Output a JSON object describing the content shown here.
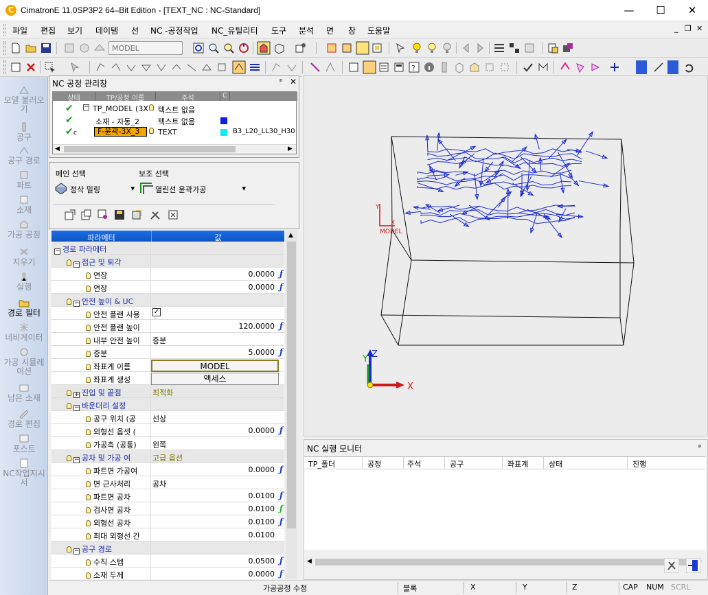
{
  "window": {
    "title": "CimatronE 11.0SP3P2 64–Bit Edition - [TEXT_NC : NC-Standard]",
    "app_icon": "C",
    "minimize": "—",
    "maximize": "☐",
    "close": "✕"
  },
  "menu": {
    "items": [
      "파일",
      "편집",
      "보기",
      "데이템",
      "선",
      "NC -공정작업",
      "NC_유틸리티",
      "도구",
      "분석",
      "면",
      "창",
      "도움말"
    ],
    "mdi_minimize": "_",
    "mdi_restore": "❐",
    "mdi_close": "✕"
  },
  "toolbar": {
    "model_select": "MODEL"
  },
  "left_bar": {
    "items": [
      "모델 불러오기",
      "공구",
      "공구 경로",
      "파트",
      "소재",
      "가공 공정",
      "지우기",
      "실행",
      "경로 필터",
      "네비게이터",
      "가공 시뮬레이션",
      "남은 소재",
      "경로 편집",
      "포스트",
      "NC작업지시서"
    ]
  },
  "nc_manager": {
    "title": "NC 공정 관리창",
    "pin": "ᵖ",
    "close": "✕",
    "columns": [
      "상태",
      "TP/공정 이름",
      "주석",
      "C"
    ],
    "rows": [
      {
        "name": "TP_MODEL (3X",
        "comment": "텍스트 없음",
        "color": "",
        "extra": ""
      },
      {
        "name": "소재 - 자동_2",
        "comment": "텍스트 없음",
        "color": "#0a1ee6",
        "extra": ""
      },
      {
        "name": "F-윤곽-3X_3",
        "comment": "TEXT",
        "color": "#11ecf4",
        "extra": "B3_L20_LL30_H30",
        "flag": "c"
      }
    ]
  },
  "process": {
    "main_label": "메인 선택",
    "sub_label": "보조 선택",
    "main_value": "정삭 밀링",
    "sub_value": "열린선 윤곽가공"
  },
  "params": {
    "col_param": "파라메터",
    "col_value": "값",
    "rows": [
      {
        "level": 0,
        "type": "group",
        "name": "경로 파라메터",
        "expand": "−"
      },
      {
        "level": 1,
        "type": "group",
        "name": "접근 및 퇴각",
        "expand": "−"
      },
      {
        "level": 2,
        "type": "num",
        "name": "연장",
        "value": "0.0000",
        "fx": "f"
      },
      {
        "level": 2,
        "type": "num",
        "name": "연장",
        "value": "0.0000",
        "fx": "f"
      },
      {
        "level": 1,
        "type": "group",
        "name": "안전 높이 & UC",
        "expand": "−"
      },
      {
        "level": 2,
        "type": "check",
        "name": "안전 플랜 사용",
        "value": "✓"
      },
      {
        "level": 2,
        "type": "num",
        "name": "안전 플랜 높이",
        "value": "120.0000",
        "fx": "f"
      },
      {
        "level": 2,
        "type": "text",
        "name": "내부 안전 높이",
        "value": "증분"
      },
      {
        "level": 2,
        "type": "num",
        "name": "증분",
        "value": "5.0000",
        "fx": "f"
      },
      {
        "level": 2,
        "type": "button",
        "name": "좌표계 이름",
        "value": "MODEL"
      },
      {
        "level": 2,
        "type": "button2",
        "name": "좌표계 생성",
        "value": "액세스"
      },
      {
        "level": 1,
        "type": "group",
        "name": "진입 및 끝점",
        "expand": "+",
        "value": "최적화"
      },
      {
        "level": 1,
        "type": "group",
        "name": "바운더리 설정",
        "expand": "−"
      },
      {
        "level": 2,
        "type": "text",
        "name": "공구 위치 (공",
        "value": "선상"
      },
      {
        "level": 2,
        "type": "num",
        "name": "외형선 옵셋 (",
        "value": "0.0000",
        "fx": "f"
      },
      {
        "level": 2,
        "type": "text",
        "name": "가공측 (공통)",
        "value": "왼쪽"
      },
      {
        "level": 1,
        "type": "group",
        "name": "공차 및 가공 여",
        "expand": "−",
        "value": "고급 옵션"
      },
      {
        "level": 2,
        "type": "num",
        "name": "파트면 가공여",
        "value": "0.0000",
        "fx": "f"
      },
      {
        "level": 2,
        "type": "text",
        "name": "면 근사처리",
        "value": "공차"
      },
      {
        "level": 2,
        "type": "num",
        "name": "파트면 공차",
        "value": "0.0100",
        "fx": "f"
      },
      {
        "level": 2,
        "type": "num",
        "name": "검사면 공차",
        "value": "0.0100",
        "fx": "fg"
      },
      {
        "level": 2,
        "type": "num",
        "name": "외형선 공차",
        "value": "0.0100",
        "fx": "f"
      },
      {
        "level": 2,
        "type": "num",
        "name": "최대 외형선 간",
        "value": "0.0100",
        "fx": ""
      },
      {
        "level": 1,
        "type": "group",
        "name": "공구 경로",
        "expand": "−"
      },
      {
        "level": 2,
        "type": "num",
        "name": "수직 스텝",
        "value": "0.0500",
        "fx": "f"
      },
      {
        "level": 2,
        "type": "num",
        "name": "소재 두께",
        "value": "0.0000",
        "fx": "f"
      }
    ]
  },
  "viewport": {
    "model_label": "MODEL",
    "axis_x": "X",
    "axis_y": "Y",
    "axis_z": "Z",
    "small_y": "Y",
    "small_x": "X"
  },
  "monitor": {
    "title": "NC 실행 모니터",
    "pin": "ᵖ",
    "columns": [
      "TP_폴더",
      "공정",
      "주석",
      "공구",
      "좌표계",
      "상태",
      "진행"
    ]
  },
  "status": {
    "message": "가공공정 수정",
    "block": "블록",
    "x": "X",
    "y": "Y",
    "z": "Z",
    "cap": "CAP",
    "num": "NUM",
    "scrl": "SCRL"
  }
}
